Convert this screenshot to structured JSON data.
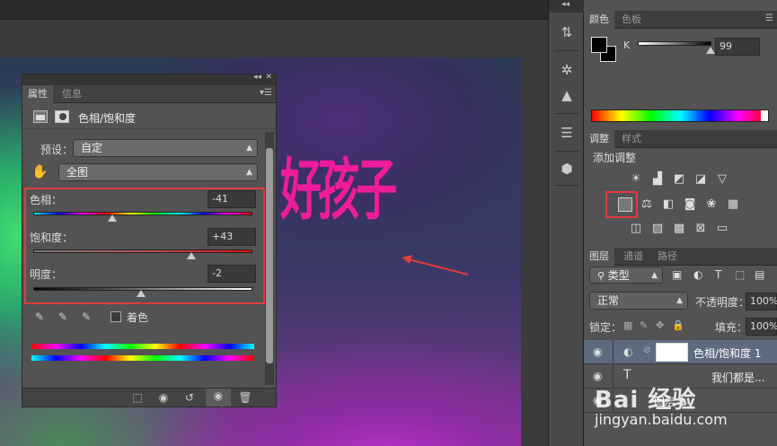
{
  "canvas": {
    "text": "好孩子"
  },
  "properties": {
    "tabs": [
      "属性",
      "信息"
    ],
    "title": "色相/饱和度",
    "preset_label": "预设：",
    "preset_value": "自定",
    "channel_value": "全图",
    "hue": {
      "label": "色相：",
      "value": "-41",
      "level": 0.36
    },
    "saturation": {
      "label": "饱和度：",
      "value": "+43",
      "level": 0.72
    },
    "lightness": {
      "label": "明度：",
      "value": "-2",
      "level": 0.49
    },
    "colorize_label": "着色"
  },
  "color_panel": {
    "tabs": [
      "颜色",
      "色板"
    ],
    "channel_label": "K",
    "channel_value": "99",
    "channel_level": 0.99
  },
  "adjust_panel": {
    "tabs": [
      "调整",
      "样式"
    ],
    "add_label": "添加调整"
  },
  "layers_panel": {
    "tabs": [
      "图层",
      "通道",
      "路径"
    ],
    "filter_label": "类型",
    "blend_mode": "正常",
    "opacity_label": "不透明度：",
    "opacity_value": "100%",
    "lock_label": "锁定：",
    "fill_label": "填充：",
    "fill_value": "100%",
    "layers": [
      {
        "name": "色相/饱和度 1"
      },
      {
        "name": "我们都是..."
      },
      {
        "name": "图层 1"
      }
    ]
  },
  "watermark": {
    "logo": "Bai 经验",
    "url": "jingyan.baidu.com"
  },
  "colors": {
    "accent_red": "#e23b3b",
    "magenta_text": "#ee1c9b",
    "panel_bg": "#535353",
    "selected_layer": "#5d6a80"
  }
}
